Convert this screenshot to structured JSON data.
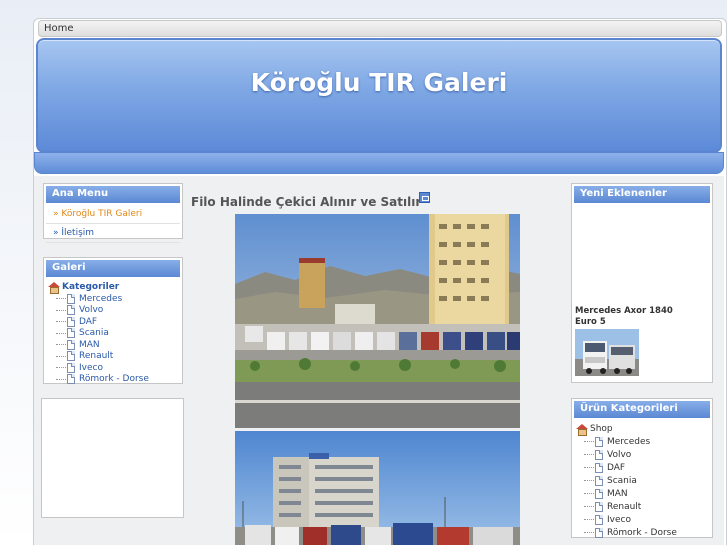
{
  "breadcrumb": {
    "home_label": "Home"
  },
  "header": {
    "title": "Köroğlu TIR Galeri"
  },
  "ana_menu": {
    "title": "Ana Menu",
    "items": [
      {
        "label": "» Köroğlu TIR Galeri",
        "active": true
      },
      {
        "label": "» İletişim",
        "active": false
      }
    ]
  },
  "galeri": {
    "title": "Galeri",
    "root_label": "Kategoriler",
    "items": [
      "Mercedes",
      "Volvo",
      "DAF",
      "Scania",
      "MAN",
      "Renault",
      "Iveco",
      "Römork - Dorse"
    ]
  },
  "main": {
    "title": "Filo Halinde Çekici Alınır ve Satılır"
  },
  "yeni_eklenenler": {
    "title": "Yeni Eklenenler",
    "product_name": "Mercedes Axor 1840 Euro 5"
  },
  "urun_kategorileri": {
    "title": "Ürün Kategorileri",
    "root_label": "Shop",
    "items": [
      "Mercedes",
      "Volvo",
      "DAF",
      "Scania",
      "MAN",
      "Renault",
      "Iveco",
      "Römork - Dorse"
    ]
  },
  "colors": {
    "accent_blue": "#5b88d4",
    "link_blue": "#2a5aa8",
    "active_orange": "#e0891a"
  }
}
